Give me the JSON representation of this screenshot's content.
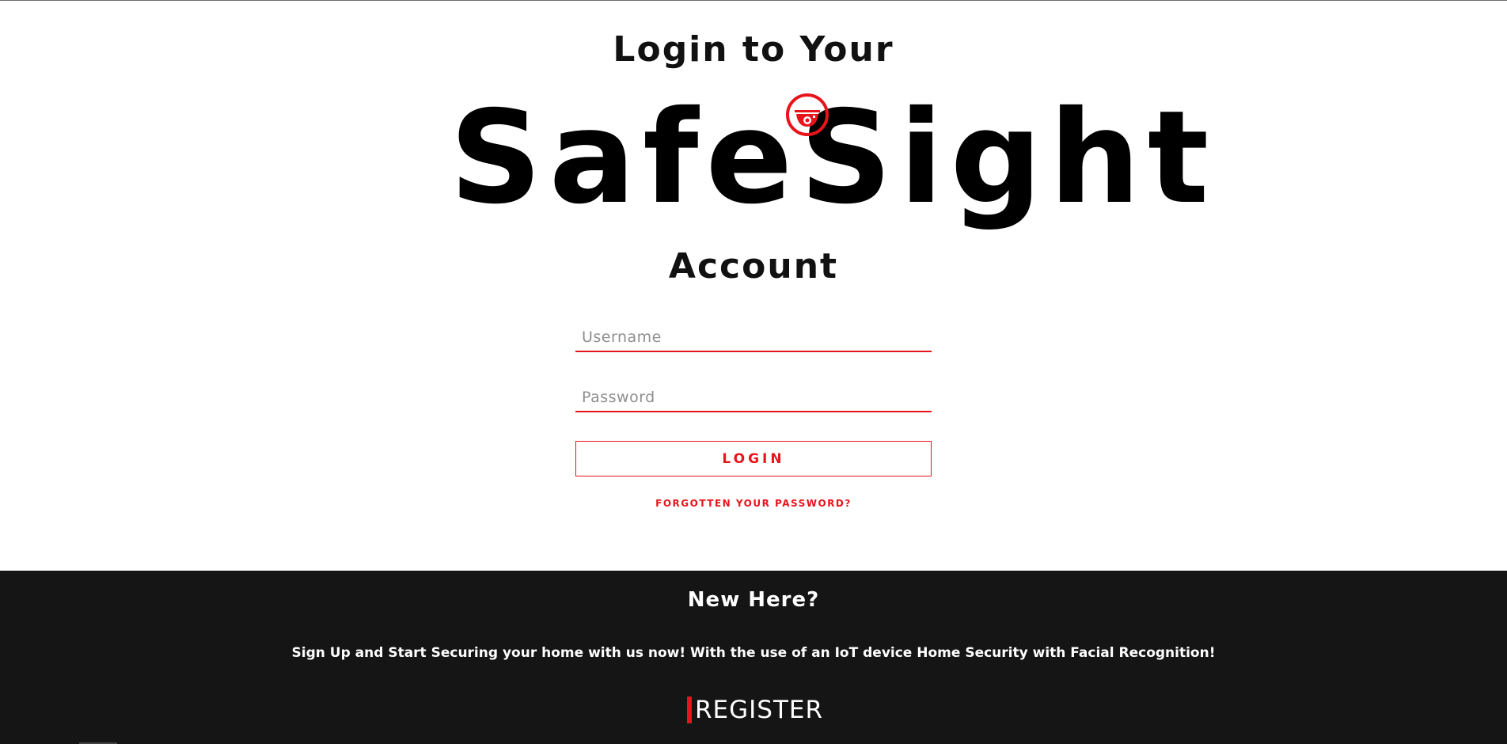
{
  "login": {
    "title_top": "Login to Your",
    "brand": "SafeSight",
    "title_bottom": "Account",
    "username_placeholder": "Username",
    "password_placeholder": "Password",
    "login_label": "LOGIN",
    "forgot_label": "FORGOTTEN YOUR PASSWORD?"
  },
  "signup": {
    "heading": "New Here?",
    "description": "Sign Up and Start Securing your home with us now! With the use of an IoT device Home Security with Facial Recognition!",
    "register_label": "REGISTER"
  },
  "colors": {
    "accent": "#e8141b",
    "footer_bg": "#151515",
    "text_dark": "#111111",
    "text_light": "#ffffff"
  },
  "icons": {
    "logo_camera": "security-camera-icon"
  }
}
